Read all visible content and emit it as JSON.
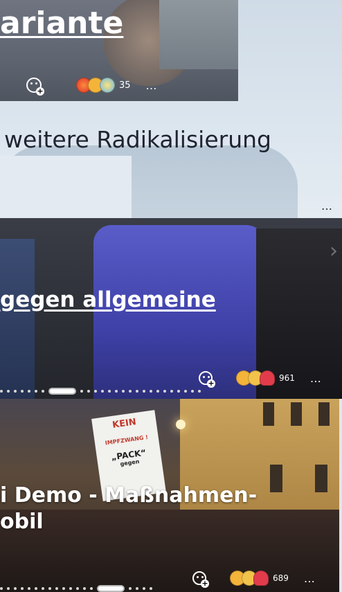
{
  "cards": [
    {
      "title": "ariante",
      "reaction_count": "35",
      "more_label": "…",
      "emojis": [
        "angry-emoji",
        "thumbs-up-emoji",
        "astonished-emoji"
      ]
    },
    {
      "title": "weitere Radikalisierung",
      "more_label": "…"
    },
    {
      "title": "gegen allgemeine",
      "reaction_count": "961",
      "more_label": "…",
      "emojis": [
        "thumbs-up-emoji",
        "surprised-emoji",
        "heart-emoji"
      ],
      "carousel_next": "›"
    },
    {
      "title_line1": "i Demo - Maßnahmen-",
      "title_line2": "obil",
      "sign_text": [
        "KEIN",
        "IMPFZWANG !",
        "„PACK“",
        "gegen"
      ],
      "reaction_count": "689",
      "more_label": "…",
      "emojis": [
        "thumbs-up-emoji",
        "surprised-emoji",
        "heart-emoji"
      ]
    }
  ],
  "colors": {
    "accent_blue": "#4b4fc2",
    "page_bg": "#dfe7ee"
  }
}
